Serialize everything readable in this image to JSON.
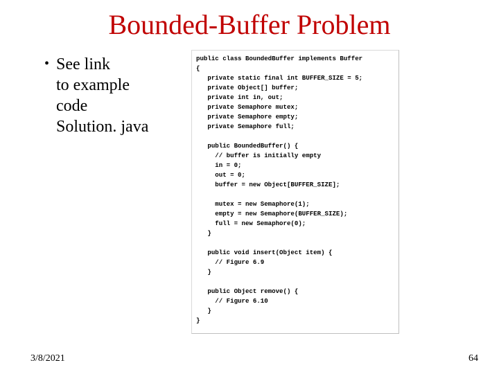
{
  "title": "Bounded-Buffer Problem",
  "bullet": {
    "marker": "•",
    "line1": "See link",
    "line2": "to example",
    "line3": "code",
    "line4": "Solution. java"
  },
  "code": "public class BoundedBuffer implements Buffer\n{\n   private static final int BUFFER_SIZE = 5;\n   private Object[] buffer;\n   private int in, out;\n   private Semaphore mutex;\n   private Semaphore empty;\n   private Semaphore full;\n\n   public BoundedBuffer() {\n     // buffer is initially empty\n     in = 0;\n     out = 0;\n     buffer = new Object[BUFFER_SIZE];\n\n     mutex = new Semaphore(1);\n     empty = new Semaphore(BUFFER_SIZE);\n     full = new Semaphore(0);\n   }\n\n   public void insert(Object item) {\n     // Figure 6.9\n   }\n\n   public Object remove() {\n     // Figure 6.10\n   }\n}",
  "footer": {
    "date": "3/8/2021",
    "page": "64"
  }
}
